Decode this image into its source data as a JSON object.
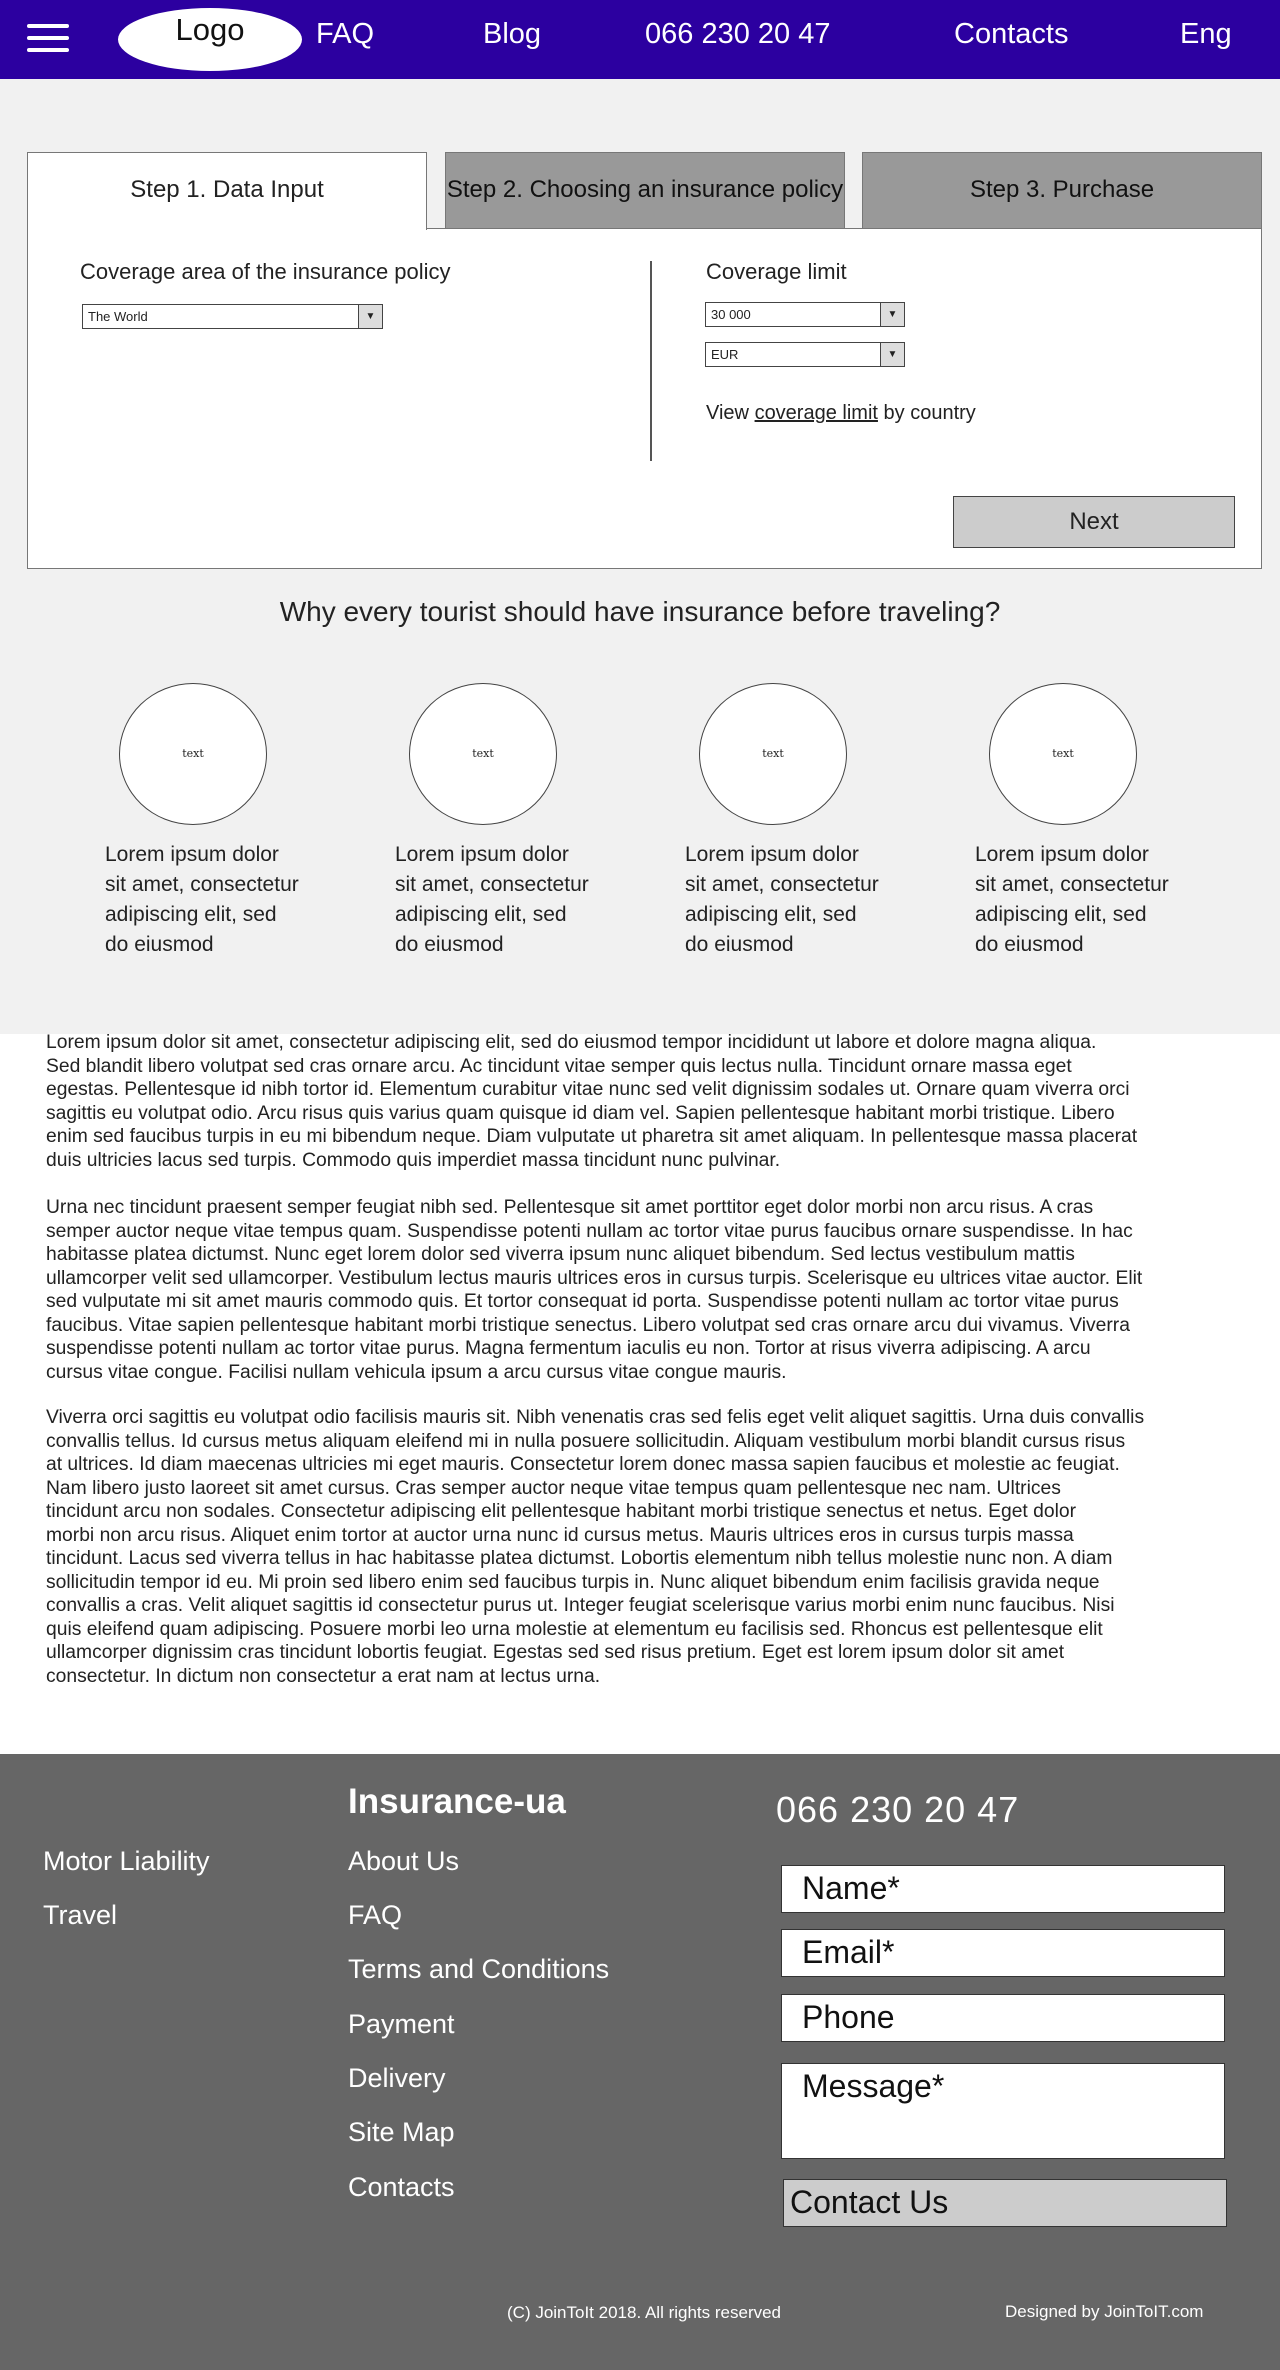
{
  "header": {
    "logo": "Logo",
    "nav": [
      "FAQ",
      "Blog",
      "066 230 20 47",
      "Contacts",
      "Eng"
    ],
    "background_color": "#2c00a0"
  },
  "steps": {
    "tabs": [
      "Step 1. Data Input",
      "Step 2. Choosing an insurance policy",
      "Step 3. Purchase"
    ],
    "active_index": 0
  },
  "form": {
    "coverage_area_label": "Coverage area of the insurance policy",
    "coverage_area_value": "The World",
    "coverage_limit_label": "Coverage limit",
    "coverage_limit_value": "30 000",
    "currency_value": "EUR",
    "view_prefix": "View",
    "view_link": "coverage limit",
    "view_suffix": "by country",
    "next_label": "Next"
  },
  "why": {
    "title": "Why every tourist should have insurance before traveling?",
    "items": [
      {
        "circle_text": "text",
        "lines": [
          "Lorem ipsum dolor",
          "sit amet, consectetur",
          "adipiscing elit, sed",
          "do eiusmod"
        ]
      },
      {
        "circle_text": "text",
        "lines": [
          "Lorem ipsum dolor",
          "sit amet, consectetur",
          "adipiscing elit, sed",
          "do eiusmod"
        ]
      },
      {
        "circle_text": "text",
        "lines": [
          "Lorem ipsum dolor",
          "sit amet, consectetur",
          "adipiscing elit, sed",
          "do eiusmod"
        ]
      },
      {
        "circle_text": "text",
        "lines": [
          "Lorem ipsum dolor",
          "sit amet, consectetur",
          "adipiscing elit, sed",
          "do eiusmod"
        ]
      }
    ]
  },
  "body_text": {
    "p1": [
      "Lorem ipsum dolor sit amet, consectetur adipiscing elit, sed do eiusmod tempor incididunt ut labore et dolore magna aliqua.",
      "Sed blandit libero volutpat sed cras ornare arcu. Ac tincidunt vitae semper quis lectus nulla. Tincidunt ornare massa eget",
      "egestas. Pellentesque id nibh tortor id. Elementum curabitur vitae nunc sed velit dignissim sodales ut. Ornare quam viverra orci",
      "sagittis eu volutpat odio. Arcu risus quis varius quam quisque id diam vel. Sapien pellentesque habitant morbi tristique. Libero",
      "enim sed faucibus turpis in eu mi bibendum neque. Diam vulputate ut pharetra sit amet aliquam. In pellentesque massa placerat",
      "duis ultricies lacus sed turpis. Commodo quis imperdiet massa tincidunt nunc pulvinar."
    ],
    "p2": [
      "Urna nec tincidunt praesent semper feugiat nibh sed. Pellentesque sit amet porttitor eget dolor morbi non arcu risus. A cras",
      "semper auctor neque vitae tempus quam. Suspendisse potenti nullam ac tortor vitae purus faucibus ornare suspendisse. In hac",
      "habitasse platea dictumst. Nunc eget lorem dolor sed viverra ipsum nunc aliquet bibendum. Sed lectus vestibulum mattis",
      "ullamcorper velit sed ullamcorper. Vestibulum lectus mauris ultrices eros in cursus turpis. Scelerisque eu ultrices vitae auctor. Elit",
      "sed vulputate mi sit amet mauris commodo quis. Et tortor consequat id porta. Suspendisse potenti nullam ac tortor vitae purus",
      "faucibus. Vitae sapien pellentesque habitant morbi tristique senectus. Libero volutpat sed cras ornare arcu dui vivamus. Viverra",
      "suspendisse potenti nullam ac tortor vitae purus. Magna fermentum iaculis eu non. Tortor at risus viverra adipiscing. A arcu",
      "cursus vitae congue. Facilisi nullam vehicula ipsum a arcu cursus vitae congue mauris."
    ],
    "p3": [
      "Viverra orci sagittis eu volutpat odio facilisis mauris sit. Nibh venenatis cras sed felis eget velit aliquet sagittis. Urna duis convallis",
      "convallis tellus. Id cursus metus aliquam eleifend mi in nulla posuere sollicitudin. Aliquam vestibulum morbi blandit cursus risus",
      "at ultrices. Id diam maecenas ultricies mi eget mauris. Consectetur lorem donec massa sapien faucibus et molestie ac feugiat.",
      "Nam libero justo laoreet sit amet cursus. Cras semper auctor neque vitae tempus quam pellentesque nec nam. Ultrices",
      "tincidunt arcu non sodales. Consectetur adipiscing elit pellentesque habitant morbi tristique senectus et netus. Eget dolor",
      "morbi non arcu risus. Aliquet enim tortor at auctor urna nunc id cursus metus. Mauris ultrices eros in cursus turpis massa",
      "tincidunt. Lacus sed viverra tellus in hac habitasse platea dictumst. Lobortis elementum nibh tellus molestie nunc non. A diam",
      "sollicitudin tempor id eu. Mi proin sed libero enim sed faucibus turpis in. Nunc aliquet bibendum enim facilisis gravida neque",
      "convallis a cras. Velit aliquet sagittis id consectetur purus ut. Integer feugiat scelerisque varius morbi enim nunc faucibus. Nisi",
      "quis eleifend quam adipiscing. Posuere morbi leo urna molestie at elementum eu facilisis sed. Rhoncus est pellentesque elit",
      "ullamcorper dignissim cras tincidunt lobortis feugiat. Egestas sed sed risus pretium. Eget est lorem ipsum dolor sit amet",
      "consectetur. In dictum non consectetur a erat nam at lectus urna."
    ]
  },
  "footer": {
    "col1": [
      "Motor Liability",
      "Travel"
    ],
    "brand": "Insurance-ua",
    "col2": [
      "About Us",
      "FAQ",
      "Terms and Conditions",
      "Payment",
      "Delivery",
      "Site Map",
      "Contacts"
    ],
    "phone": "066 230 20 47",
    "form": {
      "name_placeholder": "Name*",
      "email_placeholder": "Email*",
      "phone_placeholder": "Phone",
      "message_placeholder": "Message*",
      "submit_label": "Contact Us"
    },
    "copyright": "(C) JoinToIt 2018. All rights reserved",
    "designed_by": "Designed by JoinToIT.com",
    "background_color": "#666666"
  }
}
